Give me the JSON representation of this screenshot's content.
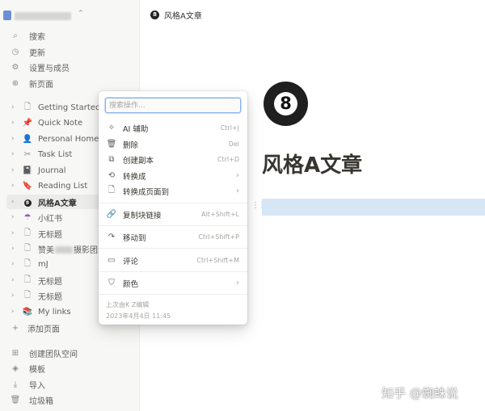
{
  "breadcrumb": {
    "icon": "billiard-ball-8-icon",
    "ball_glyph": "8",
    "title": "风格A文章"
  },
  "sidebar": {
    "workspace_chevron": "⌃",
    "actions": [
      {
        "label": "搜索",
        "icon": "search-icon"
      },
      {
        "label": "更新",
        "icon": "clock-icon"
      },
      {
        "label": "设置与成员",
        "icon": "gear-icon"
      },
      {
        "label": "新页面",
        "icon": "plus-circle-icon"
      }
    ],
    "pages": [
      {
        "label": "Getting Started",
        "icon": "document-icon"
      },
      {
        "label": "Quick Note",
        "icon": "pin-icon"
      },
      {
        "label": "Personal Home",
        "icon": "person-icon"
      },
      {
        "label": "Task List",
        "icon": "scissors-icon"
      },
      {
        "label": "Journal",
        "icon": "book-icon"
      },
      {
        "label": "Reading List",
        "icon": "bookmark-icon"
      },
      {
        "label": "风格A文章",
        "icon": "billiard-ball-8-icon",
        "active": true
      },
      {
        "label": "小红书",
        "icon": "umbrella-icon"
      },
      {
        "label": "无标题",
        "icon": "document-icon"
      },
      {
        "label_prefix": "赞美",
        "label_suffix": "摄影团队",
        "icon": "document-icon"
      },
      {
        "label": "mJ",
        "icon": "document-icon"
      },
      {
        "label": "无标题",
        "icon": "document-icon"
      },
      {
        "label": "无标题",
        "icon": "document-icon"
      },
      {
        "label": "My links",
        "icon": "books-icon"
      }
    ],
    "add_page": "添加页面",
    "bottom": [
      {
        "label": "创建团队空间",
        "icon": "team-icon"
      },
      {
        "label": "模板",
        "icon": "template-icon"
      },
      {
        "label": "导入",
        "icon": "import-icon"
      },
      {
        "label": "垃圾箱",
        "icon": "trash-icon"
      }
    ]
  },
  "page": {
    "title": "风格A文章",
    "icon_glyph": "8"
  },
  "menu": {
    "search_placeholder": "搜索操作...",
    "items": [
      {
        "label": "AI 辅助",
        "shortcut": "Ctrl+J",
        "icon": "sparkle-icon"
      },
      {
        "label": "删除",
        "shortcut": "Del",
        "icon": "trash-icon"
      },
      {
        "label": "创建副本",
        "shortcut": "Ctrl+D",
        "icon": "duplicate-icon"
      },
      {
        "label": "转换成",
        "submenu": true,
        "icon": "turn-into-icon"
      },
      {
        "label": "转换成页面到",
        "submenu": true,
        "icon": "page-icon"
      },
      {
        "label": "复制块链接",
        "shortcut": "Alt+Shift+L",
        "icon": "link-icon"
      },
      {
        "label": "移动到",
        "shortcut": "Ctrl+Shift+P",
        "icon": "move-arrow-icon"
      },
      {
        "label": "评论",
        "shortcut": "Ctrl+Shift+M",
        "icon": "comment-icon"
      },
      {
        "label": "颜色",
        "submenu": true,
        "icon": "paint-roller-icon"
      }
    ],
    "submenu_arrow": "›",
    "footer_edited_by": "上次由K Z编辑",
    "footer_time": "2023年4月4日 11:45"
  },
  "watermark": "知乎 @蜘蛛说"
}
